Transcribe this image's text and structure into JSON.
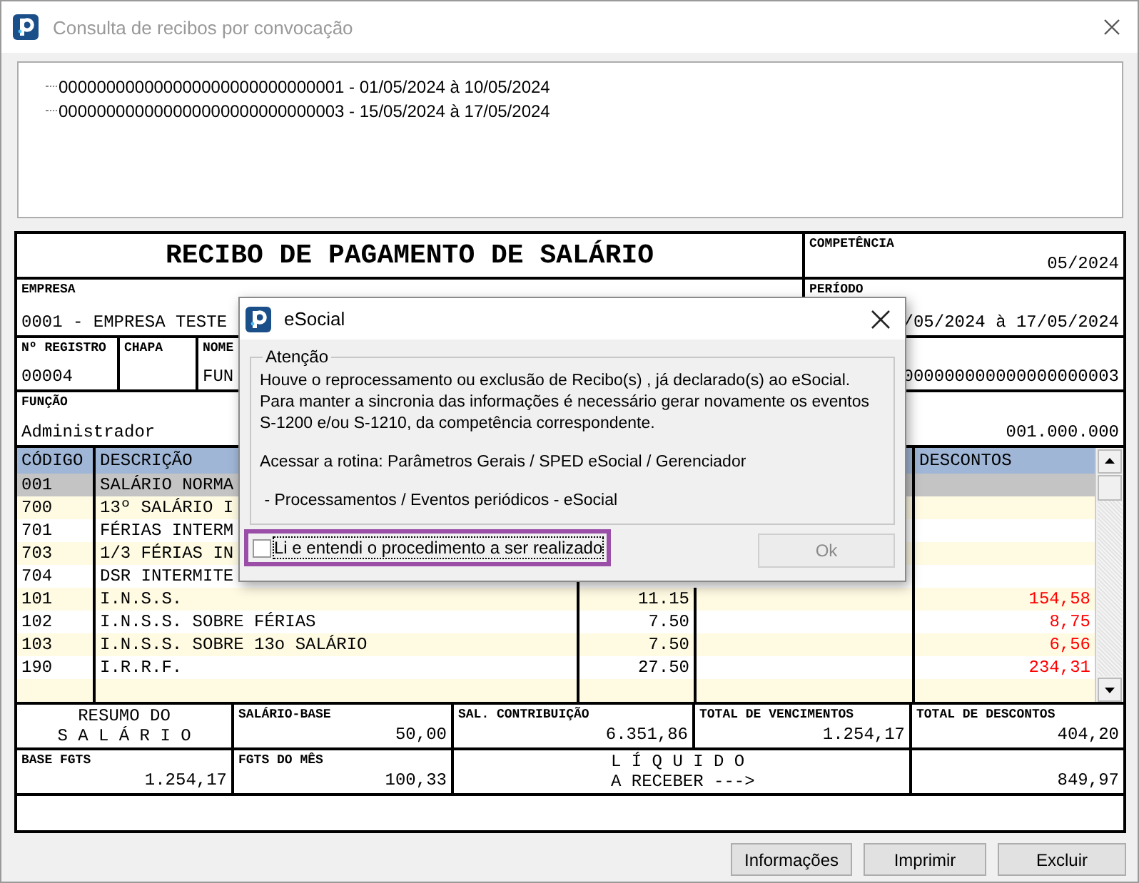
{
  "window": {
    "title": "Consulta de recibos por convocação"
  },
  "tree": [
    {
      "label": "000000000000000000000000000001 - 01/05/2024 à 10/05/2024"
    },
    {
      "label": "000000000000000000000000000003 - 15/05/2024 à 17/05/2024"
    }
  ],
  "receipt": {
    "title": "RECIBO DE PAGAMENTO DE SALÁRIO",
    "competencia": {
      "label": "COMPETÊNCIA",
      "value": "05/2024"
    },
    "empresa": {
      "label": "EMPRESA",
      "value": "0001 - EMPRESA TESTE"
    },
    "periodo": {
      "label": "PERÍODO",
      "value": "/05/2024 à 17/05/2024"
    },
    "registro": {
      "label": "Nº REGISTRO",
      "value": "00004"
    },
    "chapa": {
      "label": "CHAPA"
    },
    "nome": {
      "label": "NOME",
      "value": "FUN"
    },
    "registro_right": {
      "value": "000000000000000000003"
    },
    "funcao": {
      "label": "FUNÇÃO",
      "value": "Administrador"
    },
    "funcao_right": {
      "value": "001.000.000"
    },
    "columns": {
      "code": "CÓDIGO",
      "description": "DESCRIÇÃO",
      "discounts": "DESCONTOS"
    },
    "rows": [
      {
        "code": "001",
        "description": "SALÁRIO NORMA",
        "selected": true
      },
      {
        "code": "700",
        "description": "13º SALÁRIO I",
        "selected": false
      },
      {
        "code": "701",
        "description": "FÉRIAS INTERM",
        "selected": false
      },
      {
        "code": "703",
        "description": "1/3 FÉRIAS IN",
        "selected": false
      },
      {
        "code": "704",
        "description": "DSR INTERMITE",
        "selected": false
      },
      {
        "code": "101",
        "description": "I.N.S.S.",
        "column_3": "11.15",
        "discount": "154,58",
        "selected": false
      },
      {
        "code": "102",
        "description": "I.N.S.S. SOBRE FÉRIAS",
        "column_3": "7.50",
        "discount": "8,75",
        "selected": false
      },
      {
        "code": "103",
        "description": "I.N.S.S. SOBRE 13o SALÁRIO",
        "column_3": "7.50",
        "discount": "6,56",
        "selected": false
      },
      {
        "code": "190",
        "description": "I.R.R.F.",
        "column_3": "27.50",
        "discount": "234,31",
        "selected": false
      }
    ],
    "resumo": {
      "line_1": "RESUMO DO",
      "line_2": "S A L Á R I O"
    },
    "salario_base": {
      "label": "SALÁRIO-BASE",
      "value": "50,00"
    },
    "sal_contribuicao": {
      "label": "SAL. CONTRIBUIÇÃO",
      "value": "6.351,86"
    },
    "total_vencimentos": {
      "label": "TOTAL DE VENCIMENTOS",
      "value": "1.254,17"
    },
    "total_descontos": {
      "label": "TOTAL DE DESCONTOS",
      "value": "404,20"
    },
    "base_fgts": {
      "label": "BASE FGTS",
      "value": "1.254,17"
    },
    "fgts_mes": {
      "label": "FGTS DO MÊS",
      "value": "100,33"
    },
    "liquido": {
      "line_1": "L Í Q U I D O",
      "line_2": "A RECEBER --->",
      "value": "849,97"
    }
  },
  "dialog": {
    "title": "eSocial",
    "group": "Atenção",
    "message_lines": [
      "Houve o reprocessamento ou exclusão  de Recibo(s) , já  declarado(s) ao eSocial.",
      "Para manter a sincronia das informações é necessário gerar novamente os eventos",
      "S-1200 e/ou S-1210, da competência correspondente."
    ],
    "routine": "Acessar a rotina: Parâmetros Gerais / SPED eSocial / Gerenciador",
    "path": " - Processamentos / Eventos periódicos - eSocial",
    "checkbox": {
      "label": "Li e entendi o procedimento a ser realizado",
      "checked": false,
      "highlighted": true
    },
    "ok": {
      "label": "Ok",
      "disabled": true
    }
  },
  "buttons": [
    {
      "label": "Informações"
    },
    {
      "label": "Imprimir"
    },
    {
      "label": "Excluir"
    }
  ]
}
